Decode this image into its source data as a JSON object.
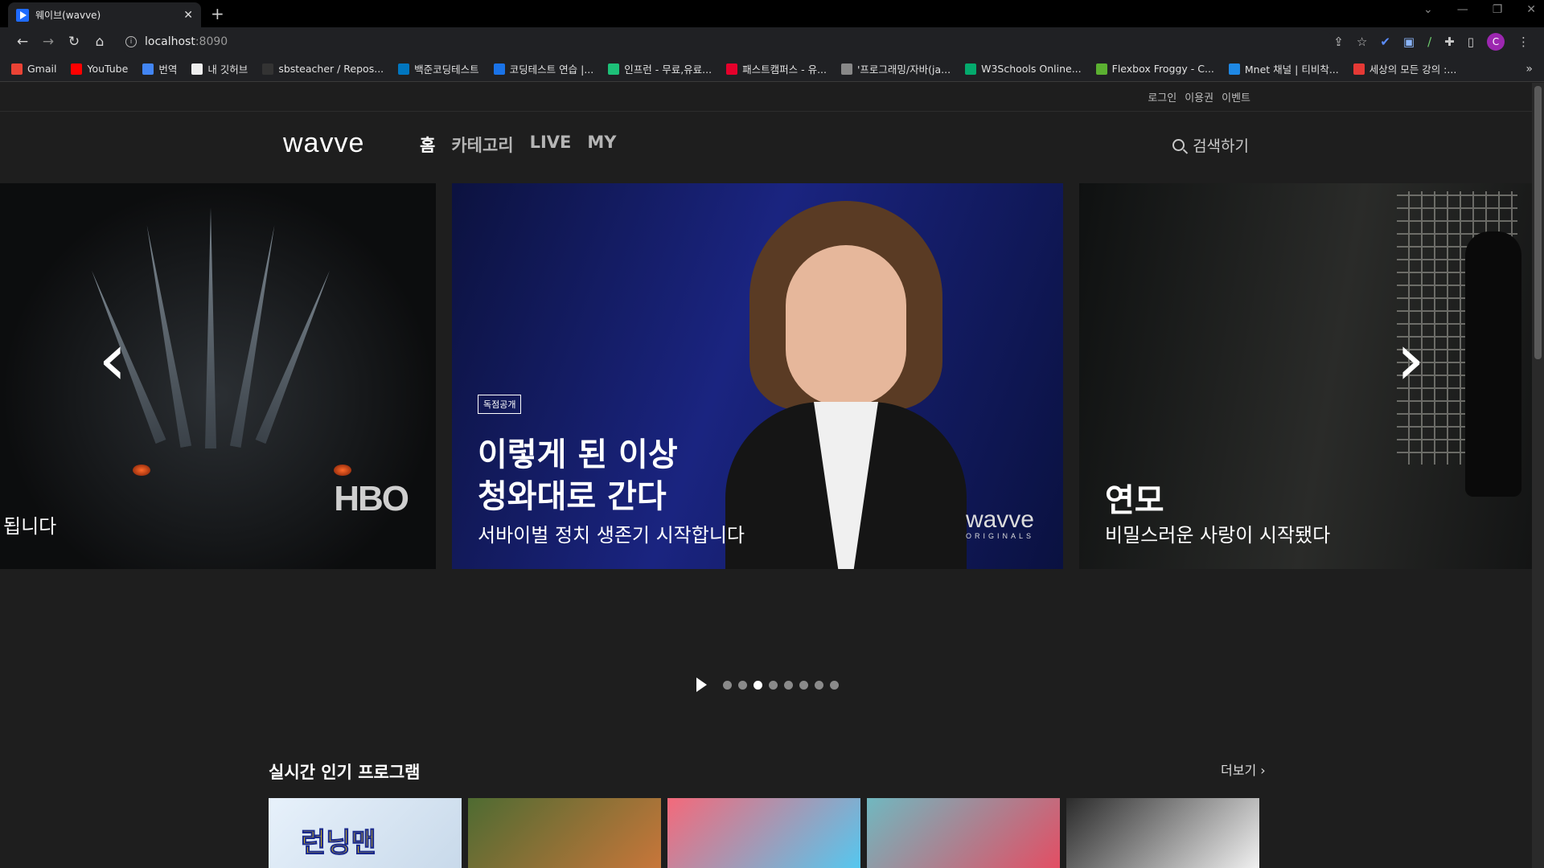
{
  "browser": {
    "tab_title": "웨이브(wavve)",
    "tab_close": "✕",
    "new_tab": "+",
    "url_host": "localhost",
    "url_port": ":8090",
    "profile_initial": "C",
    "window_controls": [
      "⌄",
      "—",
      "❐",
      "✕"
    ],
    "bookmarks": [
      {
        "label": "Gmail",
        "color": "#ea4335"
      },
      {
        "label": "YouTube",
        "color": "#ff0000"
      },
      {
        "label": "번역",
        "color": "#4285f4"
      },
      {
        "label": "내 깃허브",
        "color": "#eeeeee"
      },
      {
        "label": "sbsteacher / Repos...",
        "color": "#333333"
      },
      {
        "label": "백준코딩테스트",
        "color": "#0076c0"
      },
      {
        "label": "코딩테스트 연습 |...",
        "color": "#1a73e8"
      },
      {
        "label": "인프런 - 무료,유료...",
        "color": "#1dc078"
      },
      {
        "label": "패스트캠퍼스 - 유...",
        "color": "#e5002b"
      },
      {
        "label": "'프로그래밍/자바(ja...",
        "color": "#888888"
      },
      {
        "label": "W3Schools Online...",
        "color": "#04aa6d"
      },
      {
        "label": "Flexbox Froggy - C...",
        "color": "#5bb031"
      },
      {
        "label": "Mnet 채널 | 티비착...",
        "color": "#1e88e5"
      },
      {
        "label": "세상의 모든 강의 :...",
        "color": "#e53935"
      }
    ],
    "bookmarks_more": "»"
  },
  "header": {
    "util_links": [
      "로그인",
      "이용권",
      "이벤트"
    ],
    "logo": "wavve",
    "nav": [
      {
        "label": "홈",
        "active": true
      },
      {
        "label": "카테고리",
        "active": false
      },
      {
        "label": "LIVE",
        "active": false
      },
      {
        "label": "MY",
        "active": false
      }
    ],
    "search_label": "검색하기"
  },
  "carousel": {
    "left_slide": {
      "subtitle": "됩니다",
      "brand": "HBO"
    },
    "center_slide": {
      "badge": "독점공개",
      "title_line1": "이렇게 된 이상",
      "title_line2": "청와대로 간다",
      "subtitle": "서바이벌 정치 생존기 시작합니다",
      "brand": "wavve",
      "brand_sub": "ORIGINALS"
    },
    "right_slide": {
      "title": "연모",
      "subtitle": "비밀스러운 사랑이 시작됐다"
    },
    "prev_arrow": "‹",
    "next_arrow": "›",
    "dots_total": 8,
    "active_dot": 3
  },
  "section": {
    "title": "실시간 인기 프로그램",
    "more": "더보기 ›",
    "thumbnails": [
      {
        "text": "런닝맨",
        "colors": [
          "#e7f1fb",
          "#c8d9ea"
        ]
      },
      {
        "text": "",
        "colors": [
          "#4e6b32",
          "#c9763a"
        ]
      },
      {
        "text": "",
        "colors": [
          "#f4697a",
          "#54c8f0"
        ]
      },
      {
        "text": "",
        "colors": [
          "#70b8c0",
          "#e44d63"
        ]
      },
      {
        "text": "",
        "colors": [
          "#2b2b2b",
          "#f2f2f2"
        ]
      }
    ]
  }
}
